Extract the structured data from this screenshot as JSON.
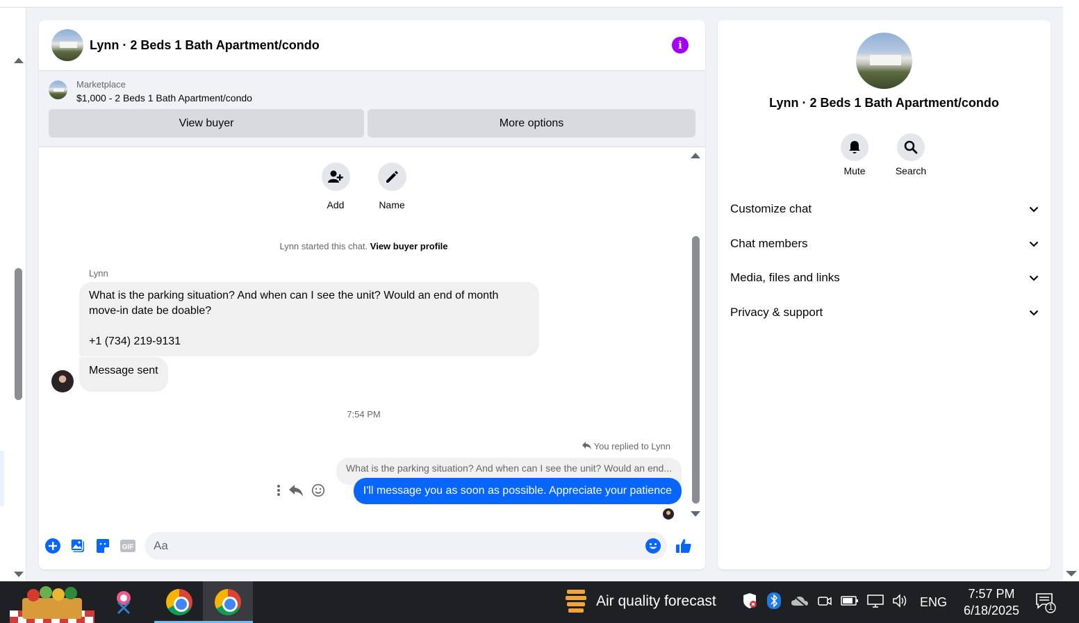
{
  "chat": {
    "title": "Lynn · 2 Beds 1 Bath Apartment/condo",
    "marketplace_label": "Marketplace",
    "listing": "$1,000 - 2 Beds 1 Bath Apartment/condo",
    "view_buyer": "View buyer",
    "more_options": "More options",
    "actions": {
      "add": "Add",
      "name": "Name"
    },
    "started_text": "Lynn started this chat.",
    "view_profile": "View buyer profile",
    "sender": "Lynn",
    "incoming_line1": "What is the parking situation? And when can I see the unit? Would an end of month move-in date be doable?",
    "incoming_phone": "+1 (734) 219-9131",
    "message_sent": "Message sent",
    "timestamp": "7:54 PM",
    "replied_to": "You replied to Lynn",
    "quoted": "What is the parking situation? And when can I see the unit? Would an end...",
    "outgoing": "I'll message you as soon as possible. Appreciate your patience",
    "composer_placeholder": "Aa"
  },
  "info": {
    "title": "Lynn · 2 Beds 1 Bath Apartment/condo",
    "mute": "Mute",
    "search": "Search",
    "sections": [
      "Customize chat",
      "Chat members",
      "Media, files and links",
      "Privacy & support"
    ]
  },
  "taskbar": {
    "weather": "Air quality forecast",
    "lang": "ENG",
    "time": "7:57 PM",
    "date": "6/18/2025",
    "notifications": "1"
  },
  "colors": {
    "accent": "#0866ff",
    "info": "#a400ff",
    "taskbar": "#1f2023"
  },
  "icons": [
    "info-icon",
    "add-person-icon",
    "pencil-icon",
    "reply-icon",
    "more-icon",
    "emoji-icon",
    "plus-icon",
    "image-icon",
    "sticker-icon",
    "gif-icon",
    "like-icon",
    "bell-icon",
    "search-icon",
    "chevron-down-icon"
  ]
}
